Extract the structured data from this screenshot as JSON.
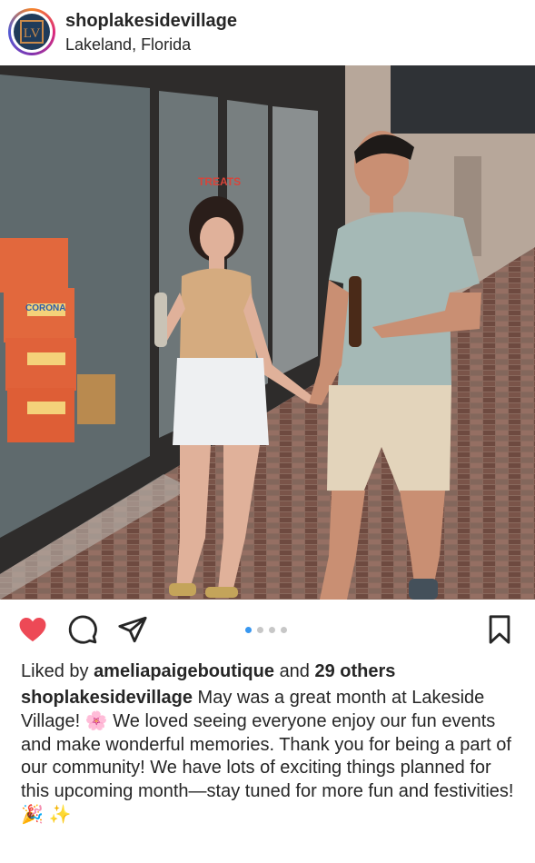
{
  "header": {
    "avatar_logo_text": "LV",
    "username": "shoplakesidevillage",
    "location": "Lakeland, Florida"
  },
  "photo": {
    "shop_sign": "TREATS",
    "box_label": "CORONA"
  },
  "actions": {
    "like_icon": "heart-filled-icon",
    "comment_icon": "comment-icon",
    "share_icon": "paper-plane-icon",
    "save_icon": "bookmark-icon",
    "carousel": {
      "total": 4,
      "current": 1
    },
    "like_color": "#ed4956"
  },
  "likes": {
    "prefix": "Liked by",
    "liker": "ameliapaigeboutique",
    "middle": "and",
    "others": "29 others"
  },
  "caption": {
    "username": "shoplakesidevillage",
    "text": "May was a great month at Lakeside Village! 🌸 We loved seeing everyone enjoy our fun events and make wonderful memories. Thank you for being a part of our community! We have lots of exciting things planned for this upcoming month—stay tuned for more fun and festivities! 🎉 ✨"
  }
}
